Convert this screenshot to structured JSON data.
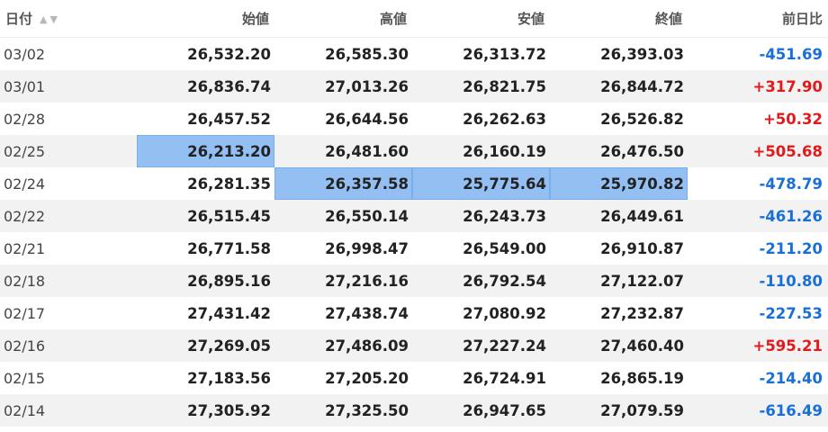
{
  "headers": [
    "日付",
    "始値",
    "高値",
    "安値",
    "終値",
    "前日比"
  ],
  "sort_icons": [
    "sort-ascending-icon",
    "sort-descending-icon"
  ],
  "colors": {
    "positive": "#e01b1b",
    "negative": "#1a6fd6",
    "selection": "#93bff3"
  },
  "rows": [
    {
      "date": "03/02",
      "open": "26,532.20",
      "high": "26,585.30",
      "low": "26,313.72",
      "close": "26,393.03",
      "change": "-451.69"
    },
    {
      "date": "03/01",
      "open": "26,836.74",
      "high": "27,013.26",
      "low": "26,821.75",
      "close": "26,844.72",
      "change": "+317.90"
    },
    {
      "date": "02/28",
      "open": "26,457.52",
      "high": "26,644.56",
      "low": "26,262.63",
      "close": "26,526.82",
      "change": "+50.32"
    },
    {
      "date": "02/25",
      "open": "26,213.20",
      "high": "26,481.60",
      "low": "26,160.19",
      "close": "26,476.50",
      "change": "+505.68"
    },
    {
      "date": "02/24",
      "open": "26,281.35",
      "high": "26,357.58",
      "low": "25,775.64",
      "close": "25,970.82",
      "change": "-478.79"
    },
    {
      "date": "02/22",
      "open": "26,515.45",
      "high": "26,550.14",
      "low": "26,243.73",
      "close": "26,449.61",
      "change": "-461.26"
    },
    {
      "date": "02/21",
      "open": "26,771.58",
      "high": "26,998.47",
      "low": "26,549.00",
      "close": "26,910.87",
      "change": "-211.20"
    },
    {
      "date": "02/18",
      "open": "26,895.16",
      "high": "27,216.16",
      "low": "26,792.54",
      "close": "27,122.07",
      "change": "-110.80"
    },
    {
      "date": "02/17",
      "open": "27,431.42",
      "high": "27,438.74",
      "low": "27,080.92",
      "close": "27,232.87",
      "change": "-227.53"
    },
    {
      "date": "02/16",
      "open": "27,269.05",
      "high": "27,486.09",
      "low": "27,227.24",
      "close": "27,460.40",
      "change": "+595.21"
    },
    {
      "date": "02/15",
      "open": "27,183.56",
      "high": "27,205.20",
      "low": "26,724.91",
      "close": "26,865.19",
      "change": "-214.40"
    },
    {
      "date": "02/14",
      "open": "27,305.92",
      "high": "27,325.50",
      "low": "26,947.65",
      "close": "27,079.59",
      "change": "-616.49"
    }
  ]
}
